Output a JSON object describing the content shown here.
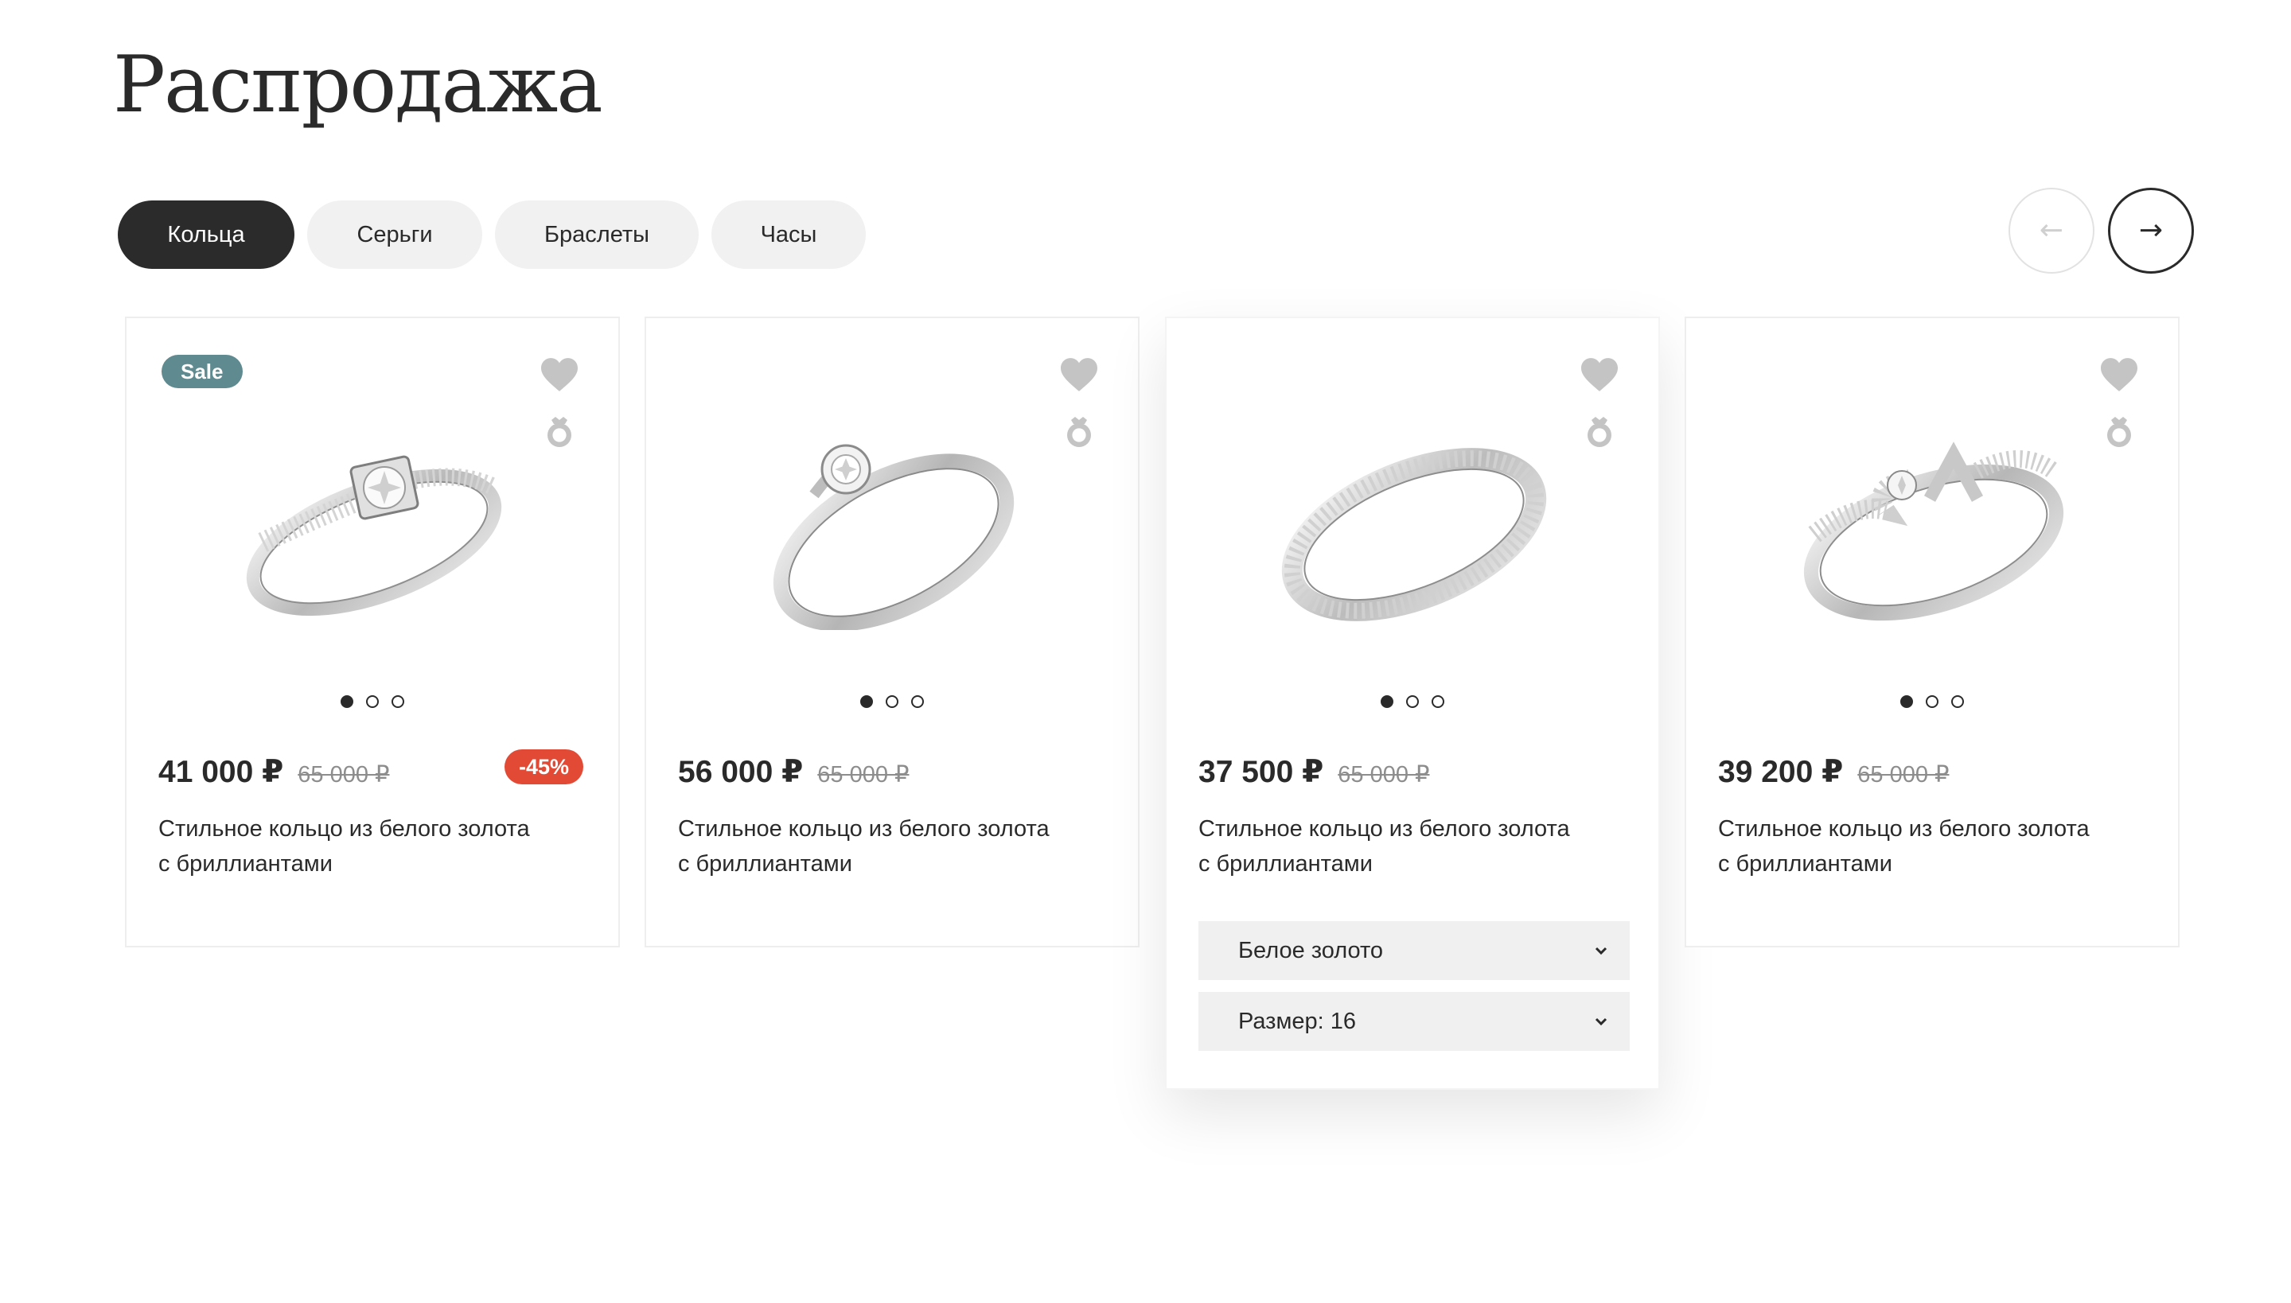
{
  "page": {
    "title": "Распродажа"
  },
  "tabs": [
    {
      "label": "Кольца",
      "active": true
    },
    {
      "label": "Серьги",
      "active": false
    },
    {
      "label": "Браслеты",
      "active": false
    },
    {
      "label": "Часы",
      "active": false
    }
  ],
  "nav": {
    "prev_icon": "arrow-left-icon",
    "prev_glyph": "←",
    "next_icon": "arrow-right-icon",
    "next_glyph": "→"
  },
  "colors": {
    "sale_badge": "#5e8a90",
    "discount_badge": "#e34a35",
    "active_tab": "#2b2b2b",
    "icon_gray": "#c4c4c4"
  },
  "products": [
    {
      "badge": "Sale",
      "price": "41 000 ₽",
      "old_price": "65 000 ₽",
      "discount": "-45%",
      "name_line1": "Стильное кольцо из белого золота",
      "name_line2": "с бриллиантами",
      "image_dots": 3,
      "active_dot": 1
    },
    {
      "price": "56 000 ₽",
      "old_price": "65 000 ₽",
      "name_line1": "Стильное кольцо из белого золота",
      "name_line2": "с бриллиантами",
      "image_dots": 3,
      "active_dot": 1
    },
    {
      "price": "37 500 ₽",
      "old_price": "65 000 ₽",
      "name_line1": "Стильное кольцо из белого золота",
      "name_line2": "с бриллиантами",
      "image_dots": 3,
      "active_dot": 1,
      "metal_select": "Белое золото",
      "size_select": "Размер: 16"
    },
    {
      "price": "39 200 ₽",
      "old_price": "65 000 ₽",
      "name_line1": "Стильное кольцо из белого золота",
      "name_line2": "с бриллиантами",
      "image_dots": 3,
      "active_dot": 1
    }
  ]
}
